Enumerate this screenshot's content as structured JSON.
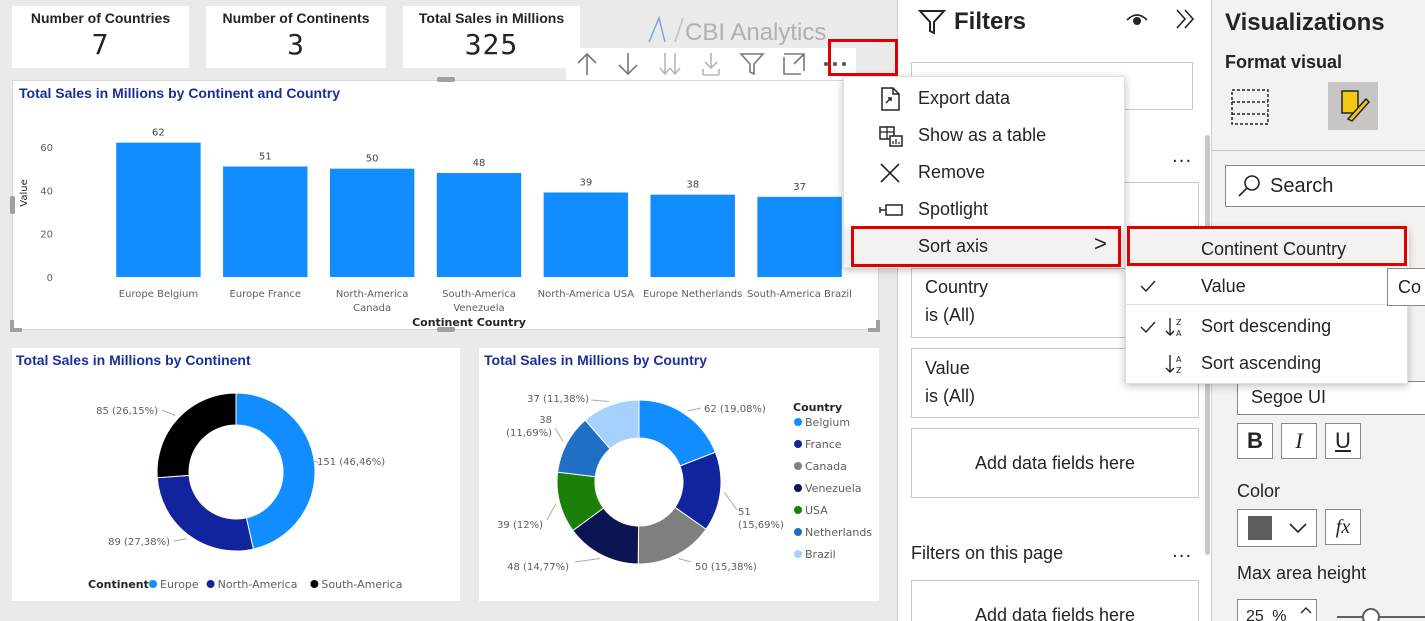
{
  "cards": [
    {
      "label": "Number of Countries",
      "value": "7"
    },
    {
      "label": "Number of Continents",
      "value": "3"
    },
    {
      "label": "Total Sales in Millions",
      "value": "325"
    }
  ],
  "logo": "CBI Analytics",
  "bar_visual": {
    "title": "Total Sales in Millions by Continent and Country",
    "chart_data": {
      "type": "bar",
      "title": "Total Sales in Millions by Continent and Country",
      "xlabel": "Continent Country",
      "ylabel": "Value",
      "categories": [
        "Europe Belgium",
        "Europe France",
        "North-America Canada",
        "South-America Venezuela",
        "North-America USA",
        "Europe Netherlands",
        "South-America Brazil"
      ],
      "category_lines": [
        [
          "Europe Belgium"
        ],
        [
          "Europe France"
        ],
        [
          "North-America",
          "Canada"
        ],
        [
          "South-America",
          "Venezuela"
        ],
        [
          "North-America USA"
        ],
        [
          "Europe Netherlands"
        ],
        [
          "South-America Brazil"
        ]
      ],
      "values": [
        62,
        51,
        50,
        48,
        39,
        38,
        37
      ],
      "yticks": [
        "0",
        "20",
        "40",
        "60"
      ],
      "ylim": [
        0,
        66
      ],
      "color": "#118dff"
    }
  },
  "donut1": {
    "title": "Total Sales in Millions by Continent",
    "chart_data": {
      "type": "pie",
      "title": "Total Sales in Millions by Continent",
      "legend_title": "Continent",
      "slices": [
        {
          "name": "Europe",
          "value": 151,
          "label": "151 (46,46%)",
          "color": "#118dff"
        },
        {
          "name": "North-America",
          "value": 89,
          "label": "89 (27,38%)",
          "color": "#12239e"
        },
        {
          "name": "South-America",
          "value": 85,
          "label": "85 (26,15%)",
          "color": "#000000"
        }
      ]
    }
  },
  "donut2": {
    "title": "Total Sales in Millions by Country",
    "chart_data": {
      "type": "pie",
      "title": "Total Sales in Millions by Country",
      "legend_title": "Country",
      "slices": [
        {
          "name": "Belgium",
          "value": 62,
          "label": "62 (19,08%)",
          "color": "#118dff"
        },
        {
          "name": "France",
          "value": 51,
          "label": "51 (15,69%)",
          "color": "#12239e"
        },
        {
          "name": "Canada",
          "value": 50,
          "label": "50 (15,38%)",
          "color": "#7f7f7f"
        },
        {
          "name": "Venezuela",
          "value": 48,
          "label": "48 (14,77%)",
          "color": "#0b1554"
        },
        {
          "name": "USA",
          "value": 39,
          "label": "39 (12%)",
          "color": "#1b8007"
        },
        {
          "name": "Netherlands",
          "value": 38,
          "label": "38 (11,69%)",
          "color": "#1f6fc5"
        },
        {
          "name": "Brazil",
          "value": 37,
          "label": "37 (11,38%)",
          "color": "#a6d1ff"
        }
      ]
    }
  },
  "context_menu": {
    "items": [
      "Export data",
      "Show as a table",
      "Remove",
      "Spotlight",
      "Sort axis"
    ],
    "chevron": ">"
  },
  "sort_submenu": {
    "items": [
      "Continent Country",
      "Value",
      "Sort descending",
      "Sort ascending"
    ],
    "tooltip": "Co"
  },
  "filters": {
    "title": "Filters",
    "more": "...",
    "country_field": "Country",
    "country_state": "is (All)",
    "value_field": "Value",
    "value_state": "is (All)",
    "add_fields": "Add data fields here",
    "page_section": "Filters on this page",
    "add_fields_page": "Add data fields here"
  },
  "visualizations": {
    "title": "Visualizations",
    "subtitle": "Format visual",
    "search_placeholder": "Search",
    "font_value": "Segoe UI",
    "bold": "B",
    "italic": "I",
    "underline": "U",
    "color_label": "Color",
    "fx": "fx",
    "max_area_label": "Max area height",
    "max_area_value": "25",
    "max_area_unit": "%"
  }
}
